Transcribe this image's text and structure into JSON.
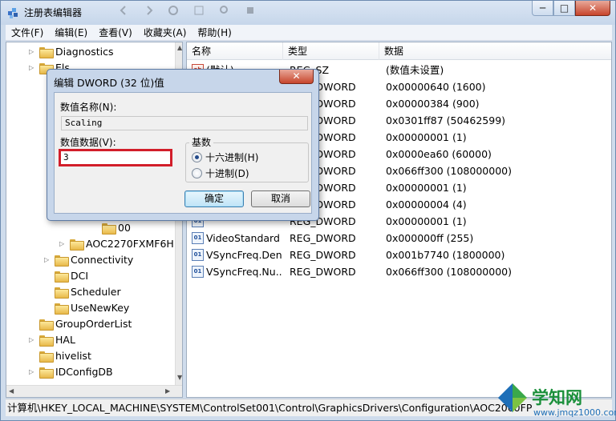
{
  "window": {
    "title": "注册表编辑器",
    "controls": {
      "minimize": "─",
      "maximize": "□",
      "close": "✕"
    }
  },
  "menubar": [
    "文件(F)",
    "编辑(E)",
    "查看(V)",
    "收藏夹(A)",
    "帮助(H)"
  ],
  "tree": {
    "items": [
      {
        "label": "Diagnostics",
        "expander": "▷"
      },
      {
        "label": "Els",
        "expander": "▷"
      },
      {
        "label": "00",
        "expander": ""
      },
      {
        "label": "AOC2270FXMF6H",
        "expander": "▷"
      },
      {
        "label": "Connectivity",
        "expander": "▷"
      },
      {
        "label": "DCI",
        "expander": ""
      },
      {
        "label": "Scheduler",
        "expander": ""
      },
      {
        "label": "UseNewKey",
        "expander": ""
      },
      {
        "label": "GroupOrderList",
        "expander": ""
      },
      {
        "label": "HAL",
        "expander": "▷"
      },
      {
        "label": "hivelist",
        "expander": ""
      },
      {
        "label": "IDConfigDB",
        "expander": "▷"
      }
    ]
  },
  "list": {
    "columns": [
      "名称",
      "类型",
      "数据"
    ],
    "rows": [
      {
        "name": "(默认)",
        "type": "REG_SZ",
        "data": "(数值未设置)",
        "icon": "string-value-icon"
      },
      {
        "name": "",
        "type": "REG_DWORD",
        "data": "0x00000640 (1600)",
        "icon": "dword-value-icon"
      },
      {
        "name": "",
        "type": "REG_DWORD",
        "data": "0x00000384 (900)",
        "icon": "dword-value-icon"
      },
      {
        "name": "",
        "type": "REG_DWORD",
        "data": "0x0301ff87 (50462599)",
        "icon": "dword-value-icon"
      },
      {
        "name": "",
        "type": "REG_DWORD",
        "data": "0x00000001 (1)",
        "icon": "dword-value-icon"
      },
      {
        "name": "",
        "type": "REG_DWORD",
        "data": "0x0000ea60 (60000)",
        "icon": "dword-value-icon"
      },
      {
        "name": "",
        "type": "REG_DWORD",
        "data": "0x066ff300 (108000000)",
        "icon": "dword-value-icon"
      },
      {
        "name": "",
        "type": "REG_DWORD",
        "data": "0x00000001 (1)",
        "icon": "dword-value-icon"
      },
      {
        "name": "",
        "type": "REG_DWORD",
        "data": "0x00000004 (4)",
        "icon": "dword-value-icon"
      },
      {
        "name": "",
        "type": "REG_DWORD",
        "data": "0x00000001 (1)",
        "icon": "dword-value-icon"
      },
      {
        "name": "VideoStandard",
        "type": "REG_DWORD",
        "data": "0x000000ff (255)",
        "icon": "dword-value-icon"
      },
      {
        "name": "VSyncFreq.Den...",
        "type": "REG_DWORD",
        "data": "0x001b7740 (1800000)",
        "icon": "dword-value-icon"
      },
      {
        "name": "VSyncFreq.Nu...",
        "type": "REG_DWORD",
        "data": "0x066ff300 (108000000)",
        "icon": "dword-value-icon"
      }
    ]
  },
  "statusbar": {
    "path": "计算机\\HKEY_LOCAL_MACHINE\\SYSTEM\\ControlSet001\\Control\\GraphicsDrivers\\Configuration\\AOC2060FP"
  },
  "dialog": {
    "title": "编辑 DWORD (32 位)值",
    "close": "✕",
    "name_label": "数值名称(N):",
    "name_value": "Scaling",
    "data_label": "数值数据(V):",
    "data_value": "3",
    "base_label": "基数",
    "radio_hex": "十六进制(H)",
    "radio_dec": "十进制(D)",
    "selected_base": "hex",
    "ok_label": "确定",
    "cancel_label": "取消"
  },
  "watermark": {
    "main": "学知网",
    "url": "www.jmqz1000.com"
  },
  "colors": {
    "highlight_border": "#d21e2a",
    "watermark_green": "#1a8f3a",
    "watermark_blue": "#1e6fb8"
  }
}
